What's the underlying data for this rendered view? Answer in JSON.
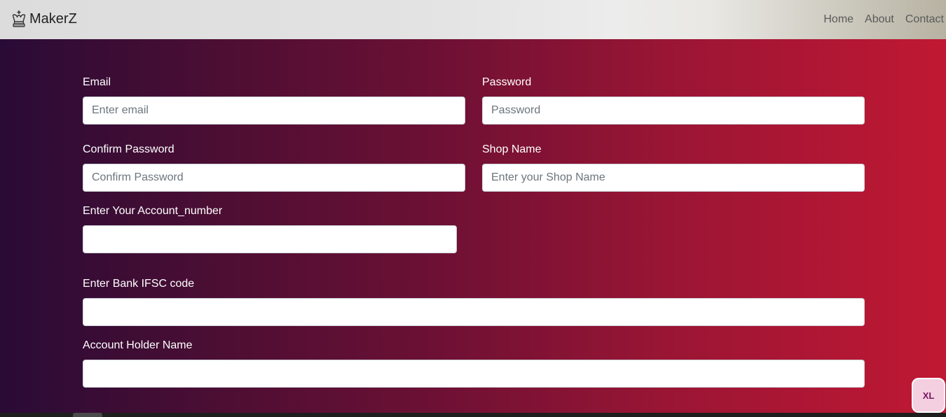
{
  "navbar": {
    "brand": "MakerZ",
    "brand_icon": "chess-king-icon",
    "links": [
      "Home",
      "About",
      "Contact"
    ]
  },
  "form": {
    "email": {
      "label": "Email",
      "placeholder": "Enter email"
    },
    "password": {
      "label": "Password",
      "placeholder": "Password"
    },
    "confirm_password": {
      "label": "Confirm Password",
      "placeholder": "Confirm Password"
    },
    "shop_name": {
      "label": "Shop Name",
      "placeholder": "Enter your Shop Name"
    },
    "account_number": {
      "label": "Enter Your Account_number",
      "placeholder": ""
    },
    "ifsc": {
      "label": "Enter Bank IFSC code",
      "placeholder": ""
    },
    "holder_name": {
      "label": "Account Holder Name",
      "placeholder": ""
    }
  },
  "badge": {
    "text": "XL"
  },
  "colors": {
    "gradient_start": "#290b36",
    "gradient_end": "#c01833",
    "navbar_bg": "#dcdcdc"
  }
}
